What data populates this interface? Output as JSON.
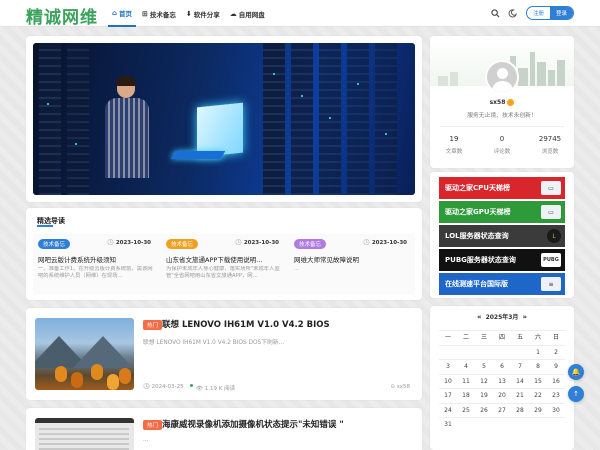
{
  "site": {
    "logo": "精诚网维"
  },
  "nav": {
    "items": [
      {
        "label": "首页",
        "icon": "home-icon",
        "active": true
      },
      {
        "label": "技术备忘",
        "icon": "sitemap-icon",
        "active": false
      },
      {
        "label": "软件分享",
        "icon": "download-icon",
        "active": false
      },
      {
        "label": "自用网盘",
        "icon": "cloud-icon",
        "active": false
      }
    ],
    "login_label": "注册",
    "register_label": "登录"
  },
  "featured": {
    "title": "精选导读",
    "items": [
      {
        "badge": "技术备忘",
        "badge_color": "#2f7fd6",
        "date": "2023-10-30",
        "title": "网吧云版计费系统升级须知",
        "desc": "一、准备工作1、在升级云版计费系统前，需该网吧的系统维护人员（网维）在现场..."
      },
      {
        "badge": "技术备忘",
        "badge_color": "#f0a020",
        "date": "2023-10-30",
        "title": "山东省文旅通APP下载使用说明...",
        "desc": "为保护未成年人身心健康，落实场所\"未成年人监管\"全省网吧用山东省文旅通APP，网..."
      },
      {
        "badge": "技术备忘",
        "badge_color": "#b07ae0",
        "date": "2023-10-30",
        "title": "网维大师常见故障说明",
        "desc": "..."
      }
    ]
  },
  "posts": [
    {
      "tag": "热门",
      "title": "联想 LENOVO IH61M V1.0 V4.2 BIOS",
      "desc": "联想 LENOVO IH61M V1.0 V4.2 BIOS DOS下刷新...",
      "date": "2024-03-25",
      "views": "1.19 K 阅读",
      "author": "sx58"
    },
    {
      "tag": "热门",
      "title": "海康威视录像机添加摄像机状态提示\"未知错误 \"",
      "desc": "..."
    }
  ],
  "profile": {
    "name": "sx58",
    "sign": "服务无止境、技术永创新！",
    "stats": [
      {
        "value": "19",
        "label": "文章数"
      },
      {
        "value": "0",
        "label": "评论数"
      },
      {
        "value": "29745",
        "label": "浏览数"
      }
    ]
  },
  "banners": [
    {
      "label": "驱动之家CPU天梯榜",
      "color": "#d9262c",
      "chip": "▭"
    },
    {
      "label": "驱动之家GPU天梯榜",
      "color": "#2e9a3a",
      "chip": "▭"
    },
    {
      "label": "LOL服务器状态查询",
      "color": "#3b3b3b",
      "chip": "L"
    },
    {
      "label": "PUBG服务器状态查询",
      "color": "#111111",
      "chip": "PUBG"
    },
    {
      "label": "在线测速平台国际版",
      "color": "#1e66c8",
      "chip": "≡"
    }
  ],
  "calendar": {
    "title": "2025年3月",
    "weekdays": [
      "一",
      "二",
      "三",
      "四",
      "五",
      "六",
      "日"
    ],
    "weeks": [
      [
        "",
        "",
        "",
        "",
        "",
        "1",
        "2"
      ],
      [
        "3",
        "4",
        "5",
        "6",
        "7",
        "8",
        "9"
      ],
      [
        "10",
        "11",
        "12",
        "13",
        "14",
        "15",
        "16"
      ],
      [
        "17",
        "18",
        "19",
        "20",
        "21",
        "22",
        "23"
      ],
      [
        "24",
        "25",
        "26",
        "27",
        "28",
        "29",
        "30"
      ],
      [
        "31",
        "",
        "",
        "",
        "",
        "",
        ""
      ]
    ]
  },
  "float_buttons": [
    {
      "icon": "bell-icon"
    },
    {
      "icon": "arrow-up-icon"
    }
  ]
}
